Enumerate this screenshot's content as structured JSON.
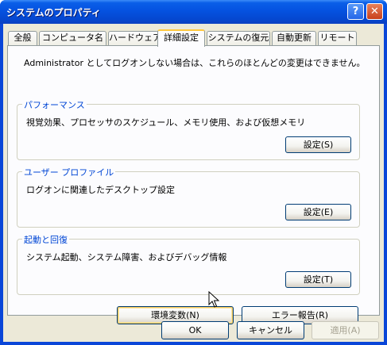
{
  "window": {
    "title": "システムのプロパティ",
    "help_glyph": "?",
    "close_glyph": "✕"
  },
  "tabs": [
    {
      "label": "全般"
    },
    {
      "label": "コンピュータ名"
    },
    {
      "label": "ハードウェア"
    },
    {
      "label": "詳細設定",
      "active": true
    },
    {
      "label": "システムの復元"
    },
    {
      "label": "自動更新"
    },
    {
      "label": "リモート"
    }
  ],
  "notice": "Administrator としてログオンしない場合は、これらのほとんどの変更はできません。",
  "groups": {
    "performance": {
      "title": "パフォーマンス",
      "description": "視覚効果、プロセッサのスケジュール、メモリ使用、および仮想メモリ",
      "button": "設定(S)"
    },
    "user_profile": {
      "title": "ユーザー プロファイル",
      "description": "ログオンに関連したデスクトップ設定",
      "button": "設定(E)"
    },
    "startup_recovery": {
      "title": "起動と回復",
      "description": "システム起動、システム障害、およびデバッグ情報",
      "button": "設定(T)"
    }
  },
  "bottom_buttons": {
    "env_vars": "環境変数(N)",
    "error_report": "エラー報告(R)"
  },
  "dialog_buttons": {
    "ok": "OK",
    "cancel": "キャンセル",
    "apply": "適用(A)"
  }
}
